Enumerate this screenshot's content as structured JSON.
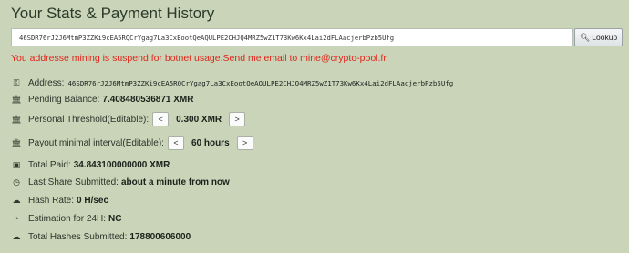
{
  "page": {
    "title": "Your Stats & Payment History"
  },
  "search": {
    "value": "46SDR76rJ2J6MtmP3ZZKi9cEA5RQCrYgag7La3CxEootQeAQULPE2CHJQ4MRZ5wZ1T73Kw6Kx4Lai2dFLAacjerbPzb5Ufg",
    "button_label": "Lookup"
  },
  "error_message": "You addresse mining is suspend for botnet usage.Send me email to mine@crypto-pool.fr",
  "stats": {
    "address_label": "Address:",
    "address_value": "46SDR76rJ2J6MtmP3ZZKi9cEA5RQCrYgag7La3CxEootQeAQULPE2CHJQ4MRZ5wZ1T73Kw6Kx4Lai2dFLAacjerbPzb5Ufg",
    "pending_label": "Pending Balance:",
    "pending_value": "7.408480536871 XMR",
    "threshold_label": "Personal Threshold(Editable):",
    "threshold_value": "0.300 XMR",
    "interval_label": "Payout minimal interval(Editable):",
    "interval_value": "60 hours",
    "paid_label": "Total Paid:",
    "paid_value": "34.843100000000 XMR",
    "last_share_label": "Last Share Submitted:",
    "last_share_value": "about a minute from now",
    "hashrate_label": "Hash Rate:",
    "hashrate_value": "0 H/sec",
    "estimation_label": "Estimation for 24H:",
    "estimation_value": "NC",
    "total_hashes_label": "Total Hashes Submitted:",
    "total_hashes_value": "178800606000"
  },
  "controls": {
    "decrease": "<",
    "increase": ">"
  },
  "icons": {
    "key": "key-icon",
    "bank": "bank-icon",
    "money": "money-icon",
    "clock": "clock-icon",
    "cloud-upload": "cloud-upload-icon",
    "dashboard": "dashboard-icon",
    "search": "search-icon"
  },
  "colors": {
    "background": "#c9d4b8",
    "error": "#e0261b"
  }
}
